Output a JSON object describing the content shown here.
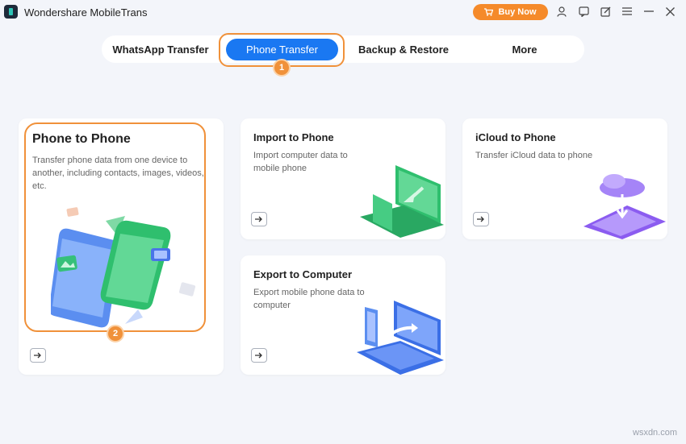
{
  "app": {
    "title": "Wondershare MobileTrans",
    "buy_label": "Buy Now",
    "accent_color": "#1a78f2",
    "highlight_color": "#f0913a"
  },
  "titlebar_icons": [
    "account-icon",
    "feedback-icon",
    "edit-icon",
    "menu-icon",
    "minimize-icon",
    "close-icon"
  ],
  "tabs": [
    {
      "label": "WhatsApp Transfer",
      "active": false
    },
    {
      "label": "Phone Transfer",
      "active": true
    },
    {
      "label": "Backup & Restore",
      "active": false
    },
    {
      "label": "More",
      "active": false
    }
  ],
  "steps": {
    "one": "1",
    "two": "2"
  },
  "cards": {
    "phone_to_phone": {
      "title": "Phone to Phone",
      "desc": "Transfer phone data from one device to another, including contacts, images, videos, etc."
    },
    "import_to_phone": {
      "title": "Import to Phone",
      "desc": "Import computer data to mobile phone"
    },
    "icloud_to_phone": {
      "title": "iCloud to Phone",
      "desc": "Transfer iCloud data to phone"
    },
    "export_to_computer": {
      "title": "Export to Computer",
      "desc": "Export mobile phone data to computer"
    }
  },
  "watermark": "wsxdn.com"
}
